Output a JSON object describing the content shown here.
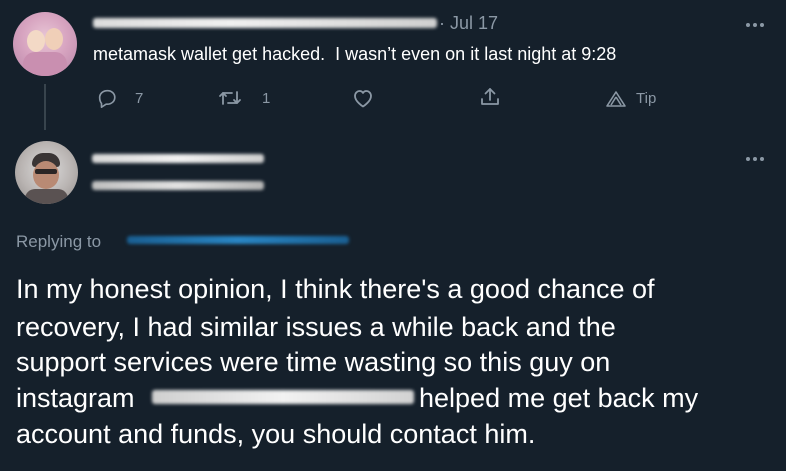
{
  "tweet": {
    "date": "· Jul 17",
    "text": "metamask wallet get hacked.  I wasn’t even on it last night at 9:28",
    "actions": {
      "reply_count": "7",
      "retweet_count": "1",
      "tip_label": "Tip"
    }
  },
  "reply": {
    "replying_to_label": "Replying to",
    "body_line1": "In my honest opinion, I think there's a good chance of",
    "body_line2": "recovery, I had similar issues a while back and the",
    "body_line3": "support services were time wasting so this guy on",
    "body_line4_prefix": "instagram",
    "body_line4_suffix": "helped me get back my",
    "body_line5": "account and funds, you should contact him."
  },
  "icons": {
    "reply": "reply-icon",
    "retweet": "retweet-icon",
    "like": "heart-icon",
    "share": "share-icon",
    "tip": "tip-icon",
    "more": "more-icon"
  },
  "colors": {
    "background": "#15202b",
    "text": "#ffffff",
    "muted": "#8b98a5",
    "thread_line": "#38444d",
    "link_blur": "#1d6fa5"
  }
}
